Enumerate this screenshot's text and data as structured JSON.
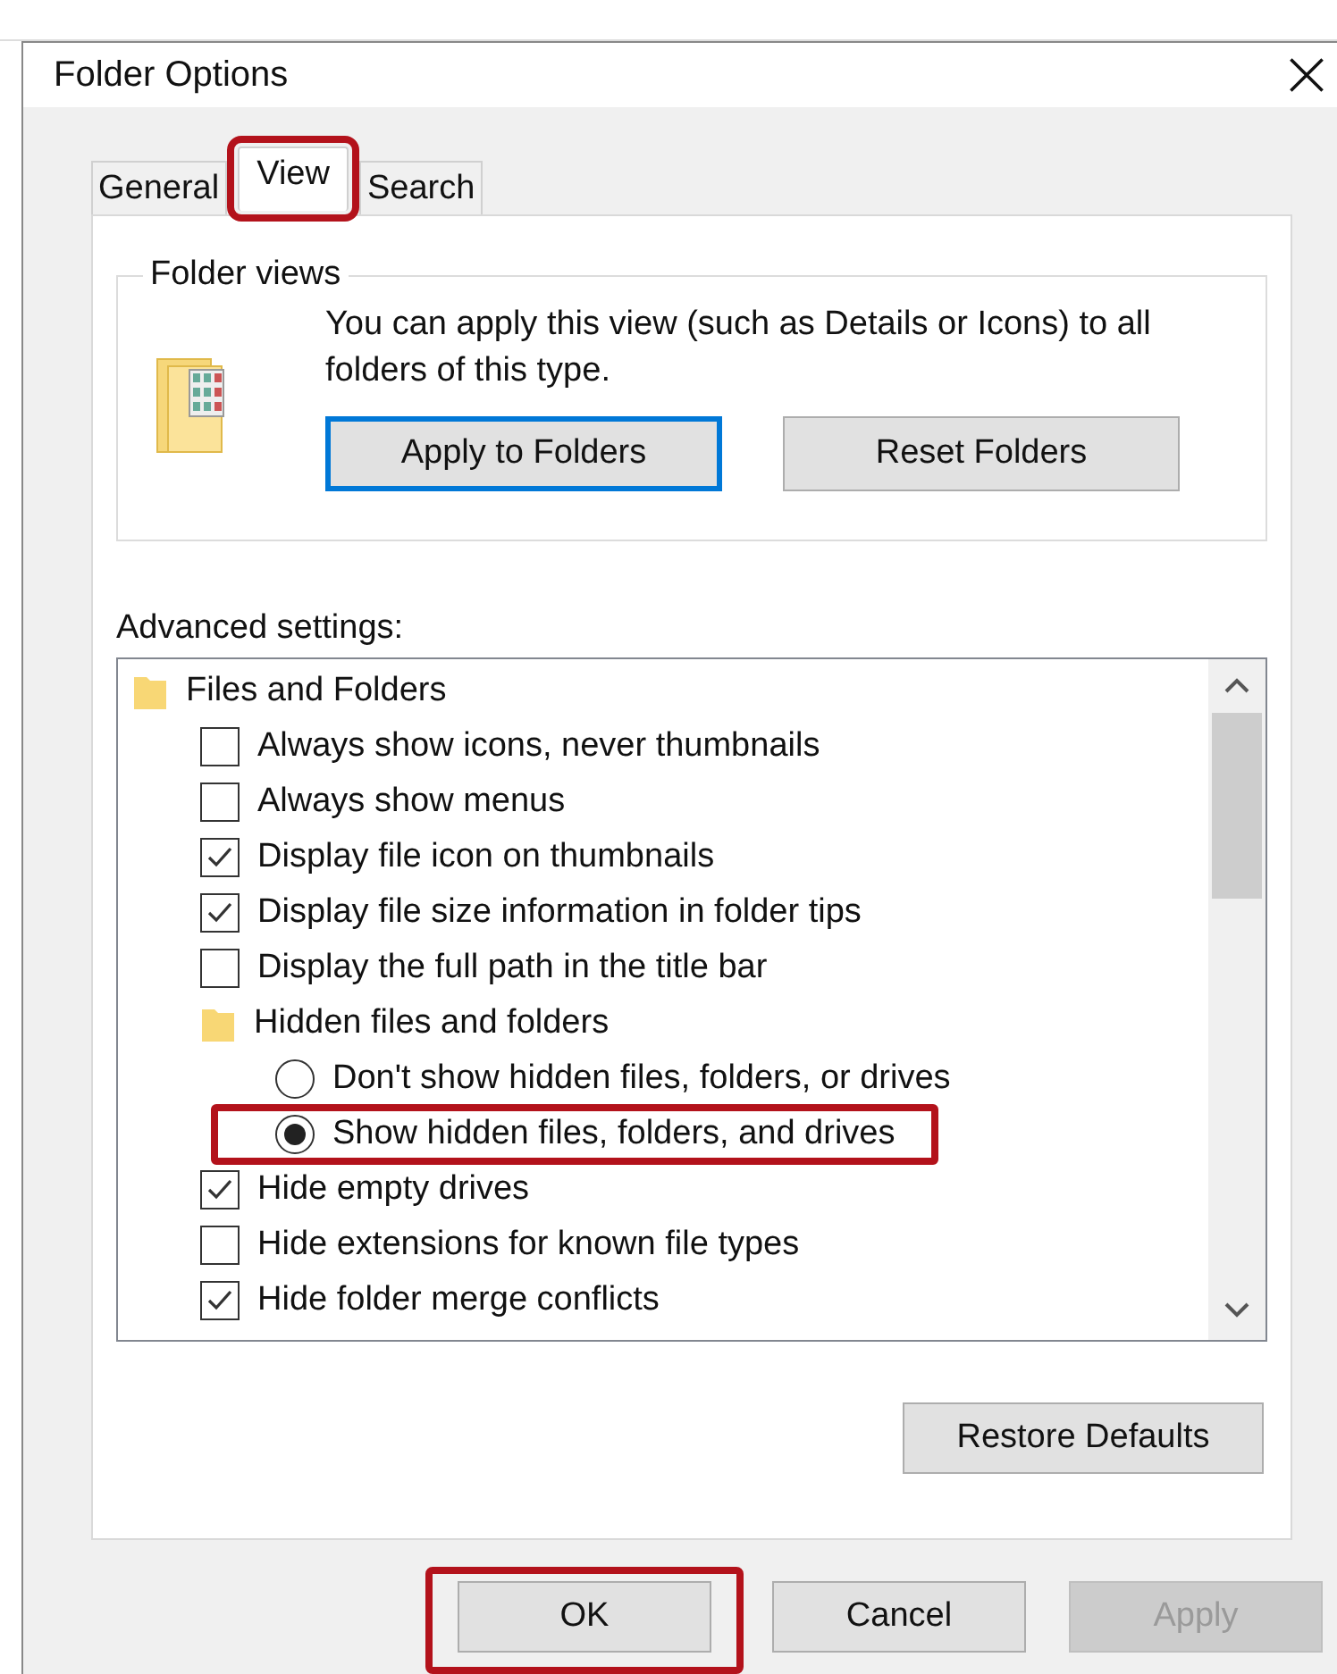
{
  "window": {
    "title": "Folder Options"
  },
  "tabs": [
    {
      "label": "General",
      "selected": false,
      "highlighted": false
    },
    {
      "label": "View",
      "selected": true,
      "highlighted": true
    },
    {
      "label": "Search",
      "selected": false,
      "highlighted": false
    }
  ],
  "folder_views": {
    "title": "Folder views",
    "description": "You can apply this view (such as Details or Icons) to all folders of this type.",
    "buttons": [
      {
        "label": "Apply to Folders",
        "focused": true
      },
      {
        "label": "Reset Folders",
        "focused": false
      }
    ]
  },
  "advanced_settings": {
    "label": "Advanced settings:",
    "items": [
      {
        "kind": "group",
        "label": "Files and Folders",
        "children": [
          {
            "kind": "checkbox",
            "label": "Always show icons, never thumbnails",
            "checked": false
          },
          {
            "kind": "checkbox",
            "label": "Always show menus",
            "checked": false
          },
          {
            "kind": "checkbox",
            "label": "Display file icon on thumbnails",
            "checked": true
          },
          {
            "kind": "checkbox",
            "label": "Display file size information in folder tips",
            "checked": true
          },
          {
            "kind": "checkbox",
            "label": "Display the full path in the title bar",
            "checked": false
          },
          {
            "kind": "group",
            "label": "Hidden files and folders",
            "children": [
              {
                "kind": "radio",
                "label": "Don't show hidden files, folders, or drives",
                "selected": false,
                "highlighted": false
              },
              {
                "kind": "radio",
                "label": "Show hidden files, folders, and drives",
                "selected": true,
                "highlighted": true
              }
            ]
          },
          {
            "kind": "checkbox",
            "label": "Hide empty drives",
            "checked": true
          },
          {
            "kind": "checkbox",
            "label": "Hide extensions for known file types",
            "checked": false
          },
          {
            "kind": "checkbox",
            "label": "Hide folder merge conflicts",
            "checked": true
          }
        ]
      }
    ]
  },
  "restore_button": "Restore Defaults",
  "buttons": [
    {
      "label": "OK",
      "disabled": false,
      "highlighted": true
    },
    {
      "label": "Cancel",
      "disabled": false,
      "highlighted": false
    },
    {
      "label": "Apply",
      "disabled": true,
      "highlighted": false
    }
  ]
}
